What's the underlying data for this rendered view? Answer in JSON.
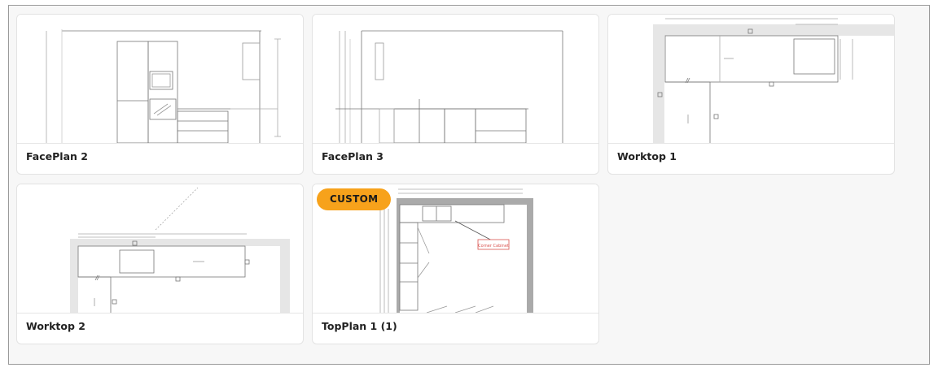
{
  "cards": [
    {
      "name": "card-faceplan-2",
      "label": "FacePlan 2"
    },
    {
      "name": "card-faceplan-3",
      "label": "FacePlan 3"
    },
    {
      "name": "card-worktop-1",
      "label": "Worktop 1"
    },
    {
      "name": "card-worktop-2",
      "label": "Worktop 2"
    },
    {
      "name": "card-topplan-1",
      "label": "TopPlan 1 (1)",
      "badge": "CUSTOM",
      "annotation": "Corner Cabinet"
    }
  ],
  "colors": {
    "badge_bg": "#f7a21b",
    "annotation_red": "#d9534f",
    "wall_gray": "#aaaaaa",
    "line_gray": "#777777"
  }
}
